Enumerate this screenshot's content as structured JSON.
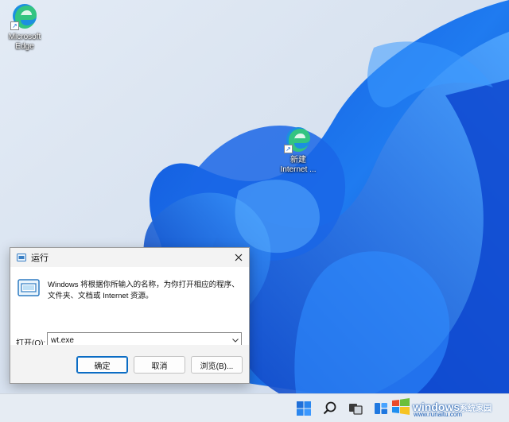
{
  "desktop": {
    "icons": [
      {
        "label": "Microsoft Edge",
        "icon": "edge-icon"
      },
      {
        "label": "新建 Internet ...",
        "icon": "edge-icon"
      }
    ]
  },
  "run_dialog": {
    "title": "运行",
    "description": "Windows 将根据你所输入的名称，为你打开相应的程序、文件夹、文档或 Internet 资源。",
    "open_label": "打开(O):",
    "open_value": "wt.exe",
    "ok_label": "确定",
    "cancel_label": "取消",
    "browse_label": "浏览(B)...",
    "close_icon": "close-icon",
    "accent_color": "#0a6cc4"
  },
  "taskbar": {
    "items": [
      "start-icon",
      "search-icon",
      "task-view-icon",
      "widgets-icon"
    ]
  },
  "watermark": {
    "main": "windows",
    "cn": "系统家园",
    "url": "www.runaitu.com"
  }
}
